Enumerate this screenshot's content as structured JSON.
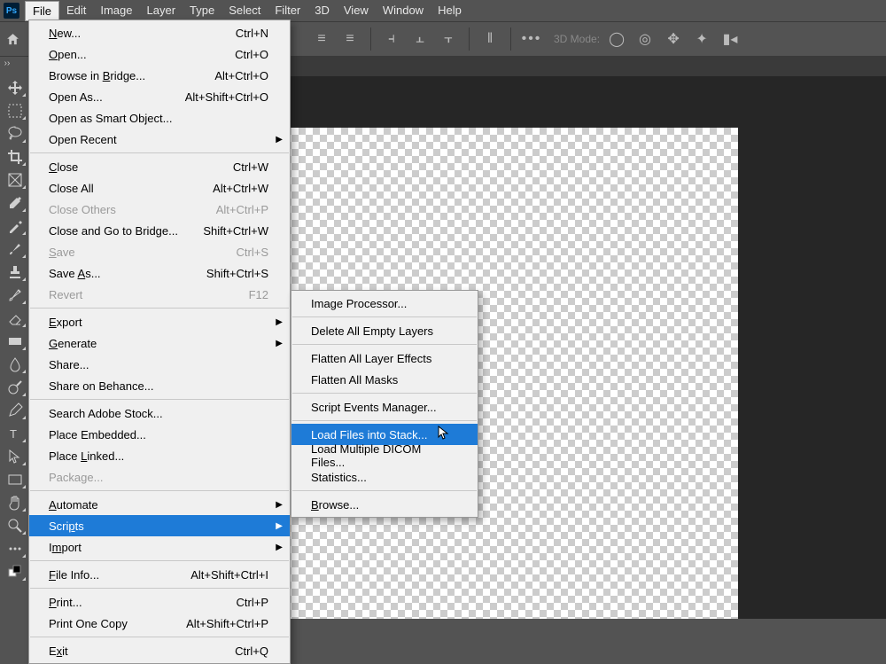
{
  "menubar": [
    "File",
    "Edit",
    "Image",
    "Layer",
    "Type",
    "Select",
    "Filter",
    "3D",
    "View",
    "Window",
    "Help"
  ],
  "menubar_open_index": 0,
  "optionsbar": {
    "mode_label": "3D Mode:"
  },
  "file_menu": [
    {
      "label": "New...",
      "u": 0,
      "shortcut": "Ctrl+N"
    },
    {
      "label": "Open...",
      "u": 0,
      "shortcut": "Ctrl+O"
    },
    {
      "label": "Browse in Bridge...",
      "u": 10,
      "shortcut": "Alt+Ctrl+O"
    },
    {
      "label": "Open As...",
      "u": -1,
      "shortcut": "Alt+Shift+Ctrl+O"
    },
    {
      "label": "Open as Smart Object...",
      "u": -1
    },
    {
      "label": "Open Recent",
      "u": -1,
      "arrow": true
    },
    {
      "sep": true
    },
    {
      "label": "Close",
      "u": 0,
      "shortcut": "Ctrl+W"
    },
    {
      "label": "Close All",
      "u": -1,
      "shortcut": "Alt+Ctrl+W"
    },
    {
      "label": "Close Others",
      "u": -1,
      "shortcut": "Alt+Ctrl+P",
      "disabled": true
    },
    {
      "label": "Close and Go to Bridge...",
      "u": -1,
      "shortcut": "Shift+Ctrl+W"
    },
    {
      "label": "Save",
      "u": 0,
      "shortcut": "Ctrl+S",
      "disabled": true
    },
    {
      "label": "Save As...",
      "u": 5,
      "shortcut": "Shift+Ctrl+S"
    },
    {
      "label": "Revert",
      "u": -1,
      "shortcut": "F12",
      "disabled": true
    },
    {
      "sep": true
    },
    {
      "label": "Export",
      "u": 0,
      "arrow": true
    },
    {
      "label": "Generate",
      "u": 0,
      "arrow": true
    },
    {
      "label": "Share...",
      "u": -1
    },
    {
      "label": "Share on Behance...",
      "u": -1
    },
    {
      "sep": true
    },
    {
      "label": "Search Adobe Stock...",
      "u": -1
    },
    {
      "label": "Place Embedded...",
      "u": -1
    },
    {
      "label": "Place Linked...",
      "u": 6
    },
    {
      "label": "Package...",
      "u": -1,
      "disabled": true
    },
    {
      "sep": true
    },
    {
      "label": "Automate",
      "u": 0,
      "arrow": true
    },
    {
      "label": "Scripts",
      "u": 4,
      "arrow": true,
      "highlight": true
    },
    {
      "label": "Import",
      "u": 1,
      "arrow": true
    },
    {
      "sep": true
    },
    {
      "label": "File Info...",
      "u": 0,
      "shortcut": "Alt+Shift+Ctrl+I"
    },
    {
      "sep": true
    },
    {
      "label": "Print...",
      "u": 0,
      "shortcut": "Ctrl+P"
    },
    {
      "label": "Print One Copy",
      "u": -1,
      "shortcut": "Alt+Shift+Ctrl+P"
    },
    {
      "sep": true
    },
    {
      "label": "Exit",
      "u": 1,
      "shortcut": "Ctrl+Q"
    }
  ],
  "scripts_submenu": [
    {
      "label": "Image Processor..."
    },
    {
      "sep": true
    },
    {
      "label": "Delete All Empty Layers"
    },
    {
      "sep": true
    },
    {
      "label": "Flatten All Layer Effects"
    },
    {
      "label": "Flatten All Masks"
    },
    {
      "sep": true
    },
    {
      "label": "Script Events Manager..."
    },
    {
      "sep": true
    },
    {
      "label": "Load Files into Stack...",
      "highlight": true
    },
    {
      "label": "Load Multiple DICOM Files..."
    },
    {
      "label": "Statistics..."
    },
    {
      "sep": true
    },
    {
      "label": "Browse...",
      "u": 0
    }
  ],
  "tools": [
    "move",
    "marquee",
    "lasso",
    "crop",
    "frame",
    "eyedropper",
    "brush-heal",
    "brush",
    "stamp",
    "history-brush",
    "eraser",
    "gradient",
    "blur",
    "dodge",
    "pen",
    "type",
    "path-select",
    "rectangle",
    "hand",
    "zoom",
    "more",
    "color-swap"
  ]
}
